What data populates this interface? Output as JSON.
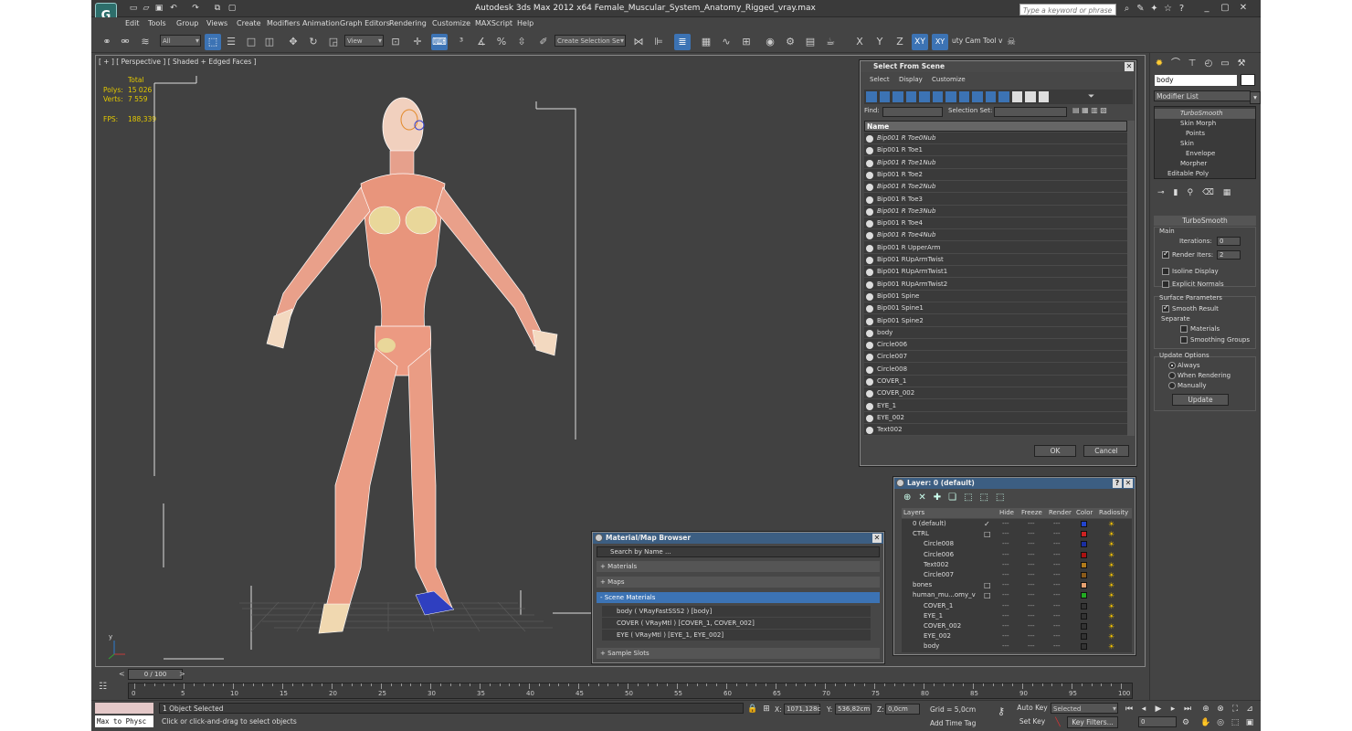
{
  "app": {
    "title": "Autodesk 3ds Max  2012 x64    Female_Muscular_System_Anatomy_Rigged_vray.max",
    "logo": "G",
    "search_placeholder": "Type a keyword or phrase"
  },
  "menu": [
    "Edit",
    "Tools",
    "Group",
    "Views",
    "Create",
    "Modifiers",
    "Animation",
    "Graph Editors",
    "Rendering",
    "Customize",
    "MAXScript",
    "Help"
  ],
  "toolbar": {
    "filter": "All",
    "ref_coord": "View",
    "selection_set": "Create Selection Se",
    "axes": [
      "X",
      "Y",
      "Z",
      "XY"
    ],
    "cam_tool": "uty Cam Tool v"
  },
  "viewport": {
    "label": "[ + ] [ Perspective ] [ Shaded + Edged Faces ]",
    "total_label": "Total",
    "polys_label": "Polys:",
    "polys_value": "15 026",
    "verts_label": "Verts:",
    "verts_value": "7 559",
    "fps_label": "FPS:",
    "fps_value": "188,339",
    "axis_y": "y"
  },
  "select_from_scene": {
    "title": "Select From Scene",
    "menu": [
      "Select",
      "Display",
      "Customize"
    ],
    "find_label": "Find:",
    "selection_set_label": "Selection Set:",
    "column_name": "Name",
    "items": [
      {
        "name": "Bip001 R Toe0Nub",
        "italic": true
      },
      {
        "name": "Bip001 R Toe1",
        "italic": false
      },
      {
        "name": "Bip001 R Toe1Nub",
        "italic": true
      },
      {
        "name": "Bip001 R Toe2",
        "italic": false
      },
      {
        "name": "Bip001 R Toe2Nub",
        "italic": true
      },
      {
        "name": "Bip001 R Toe3",
        "italic": false
      },
      {
        "name": "Bip001 R Toe3Nub",
        "italic": true
      },
      {
        "name": "Bip001 R Toe4",
        "italic": false
      },
      {
        "name": "Bip001 R Toe4Nub",
        "italic": true
      },
      {
        "name": "Bip001 R UpperArm",
        "italic": false
      },
      {
        "name": "Bip001 RUpArmTwist",
        "italic": false
      },
      {
        "name": "Bip001 RUpArmTwist1",
        "italic": false
      },
      {
        "name": "Bip001 RUpArmTwist2",
        "italic": false
      },
      {
        "name": "Bip001 Spine",
        "italic": false
      },
      {
        "name": "Bip001 Spine1",
        "italic": false
      },
      {
        "name": "Bip001 Spine2",
        "italic": false
      },
      {
        "name": "body",
        "italic": false
      },
      {
        "name": "Circle006",
        "italic": false
      },
      {
        "name": "Circle007",
        "italic": false
      },
      {
        "name": "Circle008",
        "italic": false
      },
      {
        "name": "COVER_1",
        "italic": false
      },
      {
        "name": "COVER_002",
        "italic": false
      },
      {
        "name": "EYE_1",
        "italic": false
      },
      {
        "name": "EYE_002",
        "italic": false
      },
      {
        "name": "Text002",
        "italic": false
      }
    ],
    "ok": "OK",
    "cancel": "Cancel"
  },
  "layer_dialog": {
    "title": "Layer: 0 (default)",
    "help": "?",
    "columns": [
      "Layers",
      "Hide",
      "Freeze",
      "Render",
      "Color",
      "Radiosity"
    ],
    "rows": [
      {
        "name": "0 (default)",
        "indent": 0,
        "color": "#2244cc",
        "check": "✓"
      },
      {
        "name": "CTRL",
        "indent": 0,
        "color": "#cc2222",
        "check": "□"
      },
      {
        "name": "Circle008",
        "indent": 1,
        "color": "#1a2ea0",
        "check": ""
      },
      {
        "name": "Circle006",
        "indent": 1,
        "color": "#aa1111",
        "check": ""
      },
      {
        "name": "Text002",
        "indent": 1,
        "color": "#b07a1a",
        "check": ""
      },
      {
        "name": "Circle007",
        "indent": 1,
        "color": "#8a5a1a",
        "check": ""
      },
      {
        "name": "bones",
        "indent": 0,
        "color": "#e6a070",
        "check": "□"
      },
      {
        "name": "human_mu...omy_v",
        "indent": 0,
        "color": "#22aa22",
        "check": "□"
      },
      {
        "name": "COVER_1",
        "indent": 1,
        "color": "#333333",
        "check": ""
      },
      {
        "name": "EYE_1",
        "indent": 1,
        "color": "#333333",
        "check": ""
      },
      {
        "name": "COVER_002",
        "indent": 1,
        "color": "#333333",
        "check": ""
      },
      {
        "name": "EYE_002",
        "indent": 1,
        "color": "#333333",
        "check": ""
      },
      {
        "name": "body",
        "indent": 1,
        "color": "#333333",
        "check": ""
      }
    ]
  },
  "material_browser": {
    "title": "Material/Map Browser",
    "search_placeholder": "Search by Name ...",
    "groups": {
      "materials": "+ Materials",
      "maps": "+ Maps",
      "scene": "- Scene Materials",
      "sample": "+ Sample Slots"
    },
    "scene_items": [
      "body  ( VRayFastSSS2 ) [body]",
      "COVER  ( VRayMtl ) [COVER_1, COVER_002]",
      "EYE  ( VRayMtl ) [EYE_1, EYE_002]"
    ]
  },
  "command_panel": {
    "object_name": "body",
    "modifier_list": "Modifier List",
    "stack": [
      "TurboSmooth",
      "Skin Morph",
      "Points",
      "Skin",
      "Envelope",
      "Morpher",
      "Editable Poly"
    ],
    "rollout_title": "TurboSmooth",
    "main_label": "Main",
    "iterations_label": "Iterations:",
    "iterations_value": "0",
    "render_iters_label": "Render Iters:",
    "render_iters_value": "2",
    "isoline": "Isoline Display",
    "explicit": "Explicit Normals",
    "surface_params": "Surface Parameters",
    "smooth_result": "Smooth Result",
    "separate": "Separate",
    "sep_materials": "Materials",
    "sep_smoothing": "Smoothing Groups",
    "update_options": "Update Options",
    "always": "Always",
    "when_rendering": "When Rendering",
    "manually": "Manually",
    "update_btn": "Update"
  },
  "timeline": {
    "slider": "0 / 100",
    "ticks": [
      "0",
      "5",
      "10",
      "15",
      "20",
      "25",
      "30",
      "35",
      "40",
      "45",
      "50",
      "55",
      "60",
      "65",
      "70",
      "75",
      "80",
      "85",
      "90",
      "95",
      "100"
    ]
  },
  "status": {
    "maxscript": "Max to Physc",
    "selected_text": "1 Object Selected",
    "prompt": "Click or click-and-drag to select objects",
    "x_label": "X:",
    "x_value": "1071,128c",
    "y_label": "Y:",
    "y_value": "536,82cm",
    "z_label": "Z:",
    "z_value": "0,0cm",
    "grid": "Grid = 5,0cm",
    "auto_key": "Auto Key",
    "set_key": "Set Key",
    "key_mode": "Selected",
    "add_time_tag": "Add Time Tag",
    "key_filters": "Key Filters...",
    "frame": "0"
  }
}
